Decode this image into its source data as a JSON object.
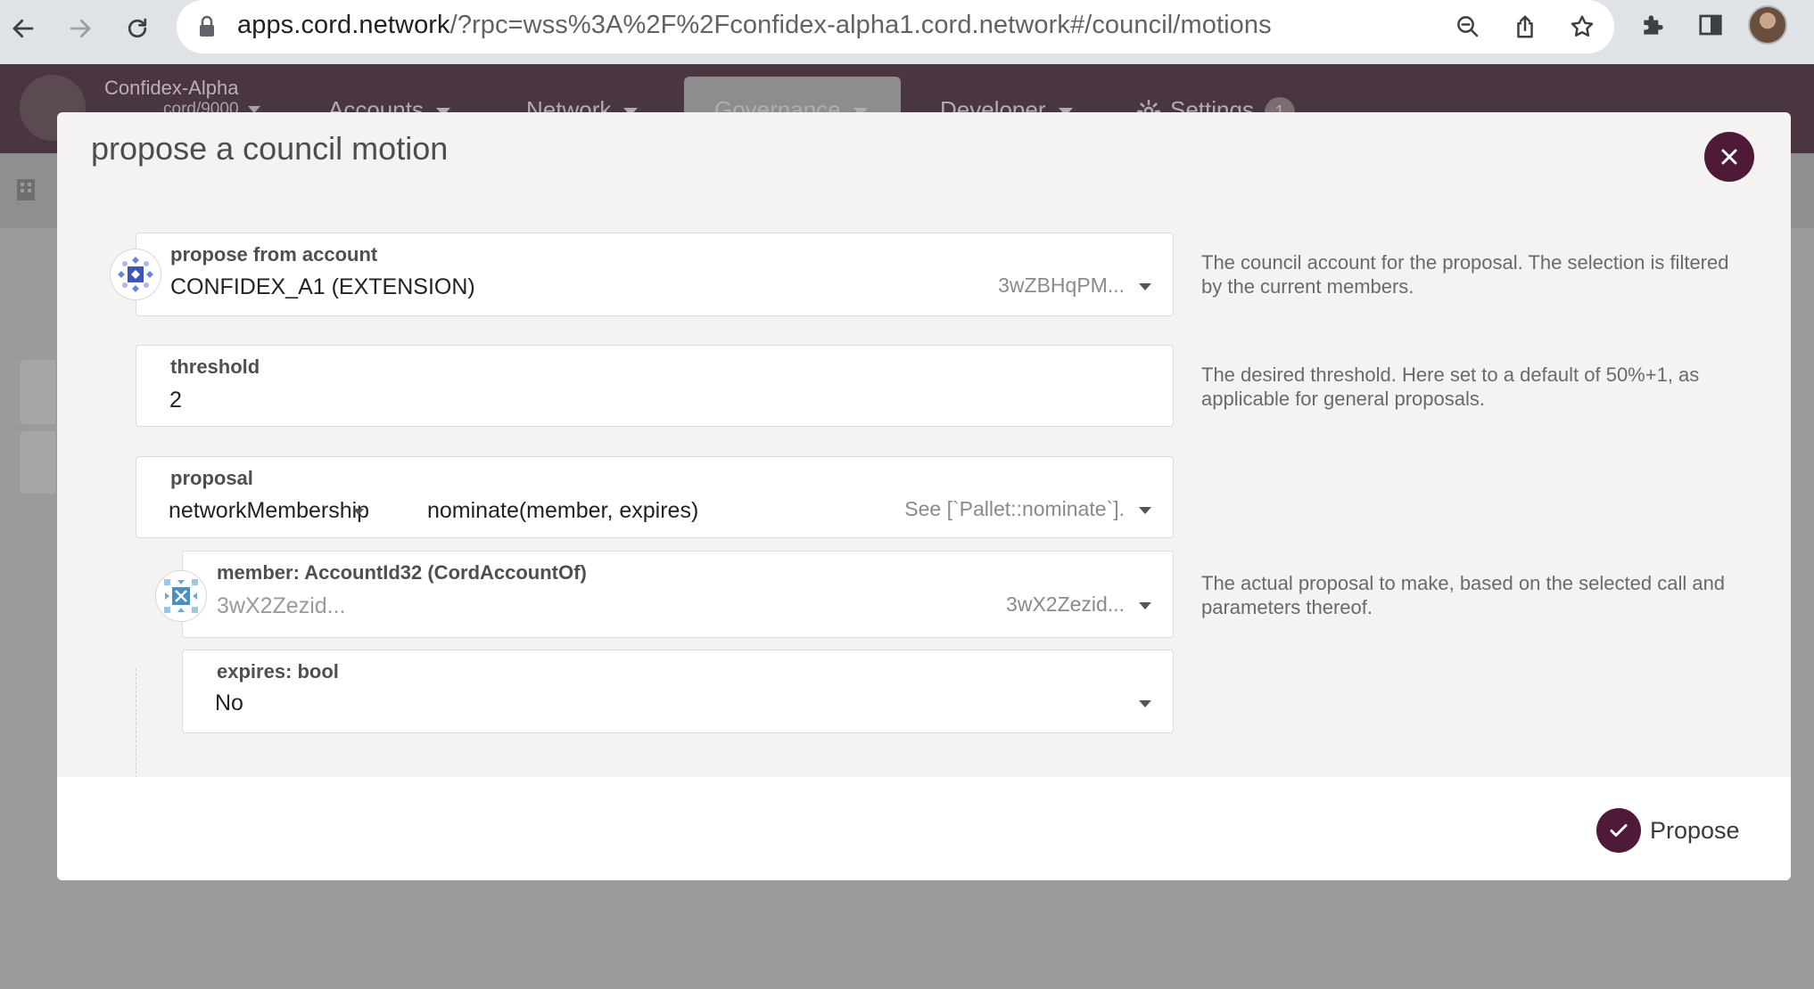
{
  "browser": {
    "url_host": "apps.cord.network",
    "url_rest": "/?rpc=wss%3A%2F%2Fconfidex-alpha1.cord.network#/council/motions"
  },
  "app": {
    "chain_name": "Confidex-Alpha",
    "chain_sub": "cord/9000",
    "menu": {
      "accounts": "Accounts",
      "network": "Network",
      "governance": "Governance",
      "developer": "Developer",
      "settings": "Settings",
      "settings_badge": "1"
    }
  },
  "modal": {
    "title": "propose a council motion",
    "account": {
      "label": "propose from account",
      "value": "CONFIDEX_A1 (EXTENSION)",
      "address": "3wZBHqPM...",
      "help": "The council account for the proposal. The selection is filtered by the current members."
    },
    "threshold": {
      "label": "threshold",
      "value": "2",
      "help": "The desired threshold. Here set to a default of 50%+1, as applicable for general proposals."
    },
    "proposal": {
      "label": "proposal",
      "section": "networkMembership",
      "method": "nominate(member, expires)",
      "doc": "See [`Pallet::nominate`].",
      "help": "The actual proposal to make, based on the selected call and parameters thereof."
    },
    "member": {
      "label": "member: AccountId32 (CordAccountOf)",
      "placeholder": "3wX2Zezid...",
      "address": "3wX2Zezid..."
    },
    "expires": {
      "label": "expires: bool",
      "value": "No"
    },
    "propose_label": "Propose"
  },
  "colors": {
    "accent": "#4e1a37",
    "header_bg": "#4a3640",
    "modal_bg": "#f4f3f2"
  }
}
